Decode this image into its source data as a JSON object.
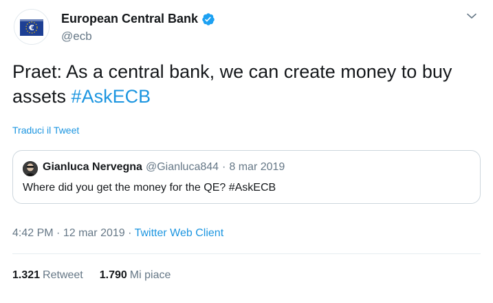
{
  "author": {
    "display_name": "European Central Bank",
    "handle": "@ecb",
    "verified": true,
    "avatar_icon": "ecb-euro-logo-icon"
  },
  "tweet": {
    "text": "Praet: As a central bank, we can create money to buy assets ",
    "hashtag": "#AskECB",
    "translate_label": "Traduci il Tweet"
  },
  "quoted_tweet": {
    "display_name": "Gianluca Nervegna",
    "handle": "@Gianluca844",
    "separator": "·",
    "date": "8 mar 2019",
    "text": "Where did you get the money for the QE? #AskECB"
  },
  "meta": {
    "time": "4:42 PM",
    "sep1": "·",
    "date": "12 mar 2019",
    "sep2": "·",
    "client": "Twitter Web Client"
  },
  "stats": {
    "retweets_count": "1.321",
    "retweets_label": "Retweet",
    "likes_count": "1.790",
    "likes_label": "Mi piace"
  },
  "colors": {
    "link": "#1b95e0",
    "secondary_text": "#657786",
    "primary_text": "#14171a",
    "ecb_blue": "#1d3f94"
  }
}
